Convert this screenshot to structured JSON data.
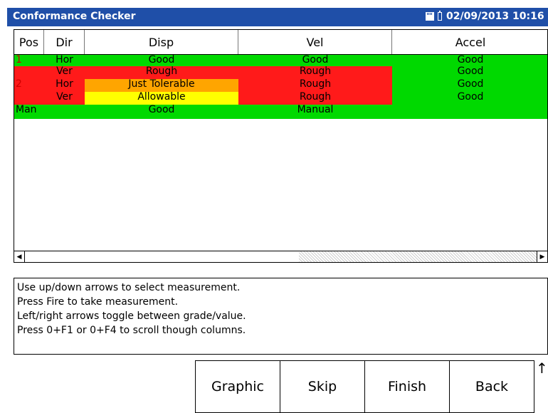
{
  "titlebar": {
    "title": "Conformance Checker",
    "datetime": "02/09/2013 10:16"
  },
  "table": {
    "headers": [
      "Pos",
      "Dir",
      "Disp",
      "Vel",
      "Accel"
    ],
    "rows": [
      {
        "pos": "1",
        "dir": "Hor",
        "disp": "Good",
        "vel": "Good",
        "accel": "Good"
      },
      {
        "pos": "",
        "dir": "Ver",
        "disp": "Rough",
        "vel": "Rough",
        "accel": "Good"
      },
      {
        "pos": "2",
        "dir": "Hor",
        "disp": "Just Tolerable",
        "vel": "Rough",
        "accel": "Good"
      },
      {
        "pos": "",
        "dir": "Ver",
        "disp": "Allowable",
        "vel": "Rough",
        "accel": "Good"
      },
      {
        "pos": "Man",
        "dir": "",
        "disp": "Good",
        "vel": "Manual",
        "accel": ""
      }
    ]
  },
  "colors": {
    "good": "#00d900",
    "rough": "#ff1a1a",
    "just_tolerable": "#ffa500",
    "allowable": "#ffff00",
    "titlebar": "#1f4fa8"
  },
  "instructions": [
    "Use up/down arrows to select measurement.",
    "Press Fire to take measurement.",
    "Left/right arrows toggle between grade/value.",
    "Press 0+F1 or 0+F4 to scroll though columns."
  ],
  "softkeys": {
    "f1": "Graphic",
    "f2": "Skip",
    "f3": "Finish",
    "f4": "Back"
  },
  "icons": {
    "sd_card": "sd-card-icon",
    "battery": "battery-icon",
    "scroll_left": "arrow-left-icon",
    "scroll_right": "arrow-right-icon",
    "up": "up-arrow-icon"
  }
}
